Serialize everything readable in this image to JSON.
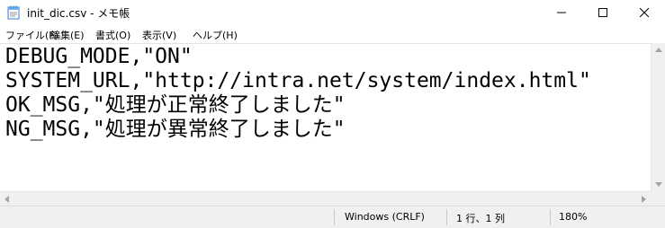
{
  "window": {
    "title": "init_dic.csv - メモ帳",
    "app_icon": "notepad-icon",
    "controls": {
      "minimize": "minimize-icon",
      "maximize": "maximize-icon",
      "close": "close-icon"
    }
  },
  "menu": {
    "items": [
      {
        "label": "ファイル(F)"
      },
      {
        "label": "編集(E)"
      },
      {
        "label": "書式(O)"
      },
      {
        "label": "表示(V)"
      },
      {
        "label": "ヘルプ(H)"
      }
    ]
  },
  "editor": {
    "lines": [
      "DEBUG_MODE,\"ON\"",
      "SYSTEM_URL,\"http://intra.net/system/index.html\"",
      "OK_MSG,\"処理が正常終了しました\"",
      "NG_MSG,\"処理が異常終了しました\""
    ]
  },
  "status": {
    "encoding": "Windows (CRLF)",
    "position": "1 行、1 列",
    "zoom": "180%"
  },
  "colors": {
    "chrome": "#f0f0f0",
    "text": "#000000",
    "editor_bg": "#ffffff"
  }
}
